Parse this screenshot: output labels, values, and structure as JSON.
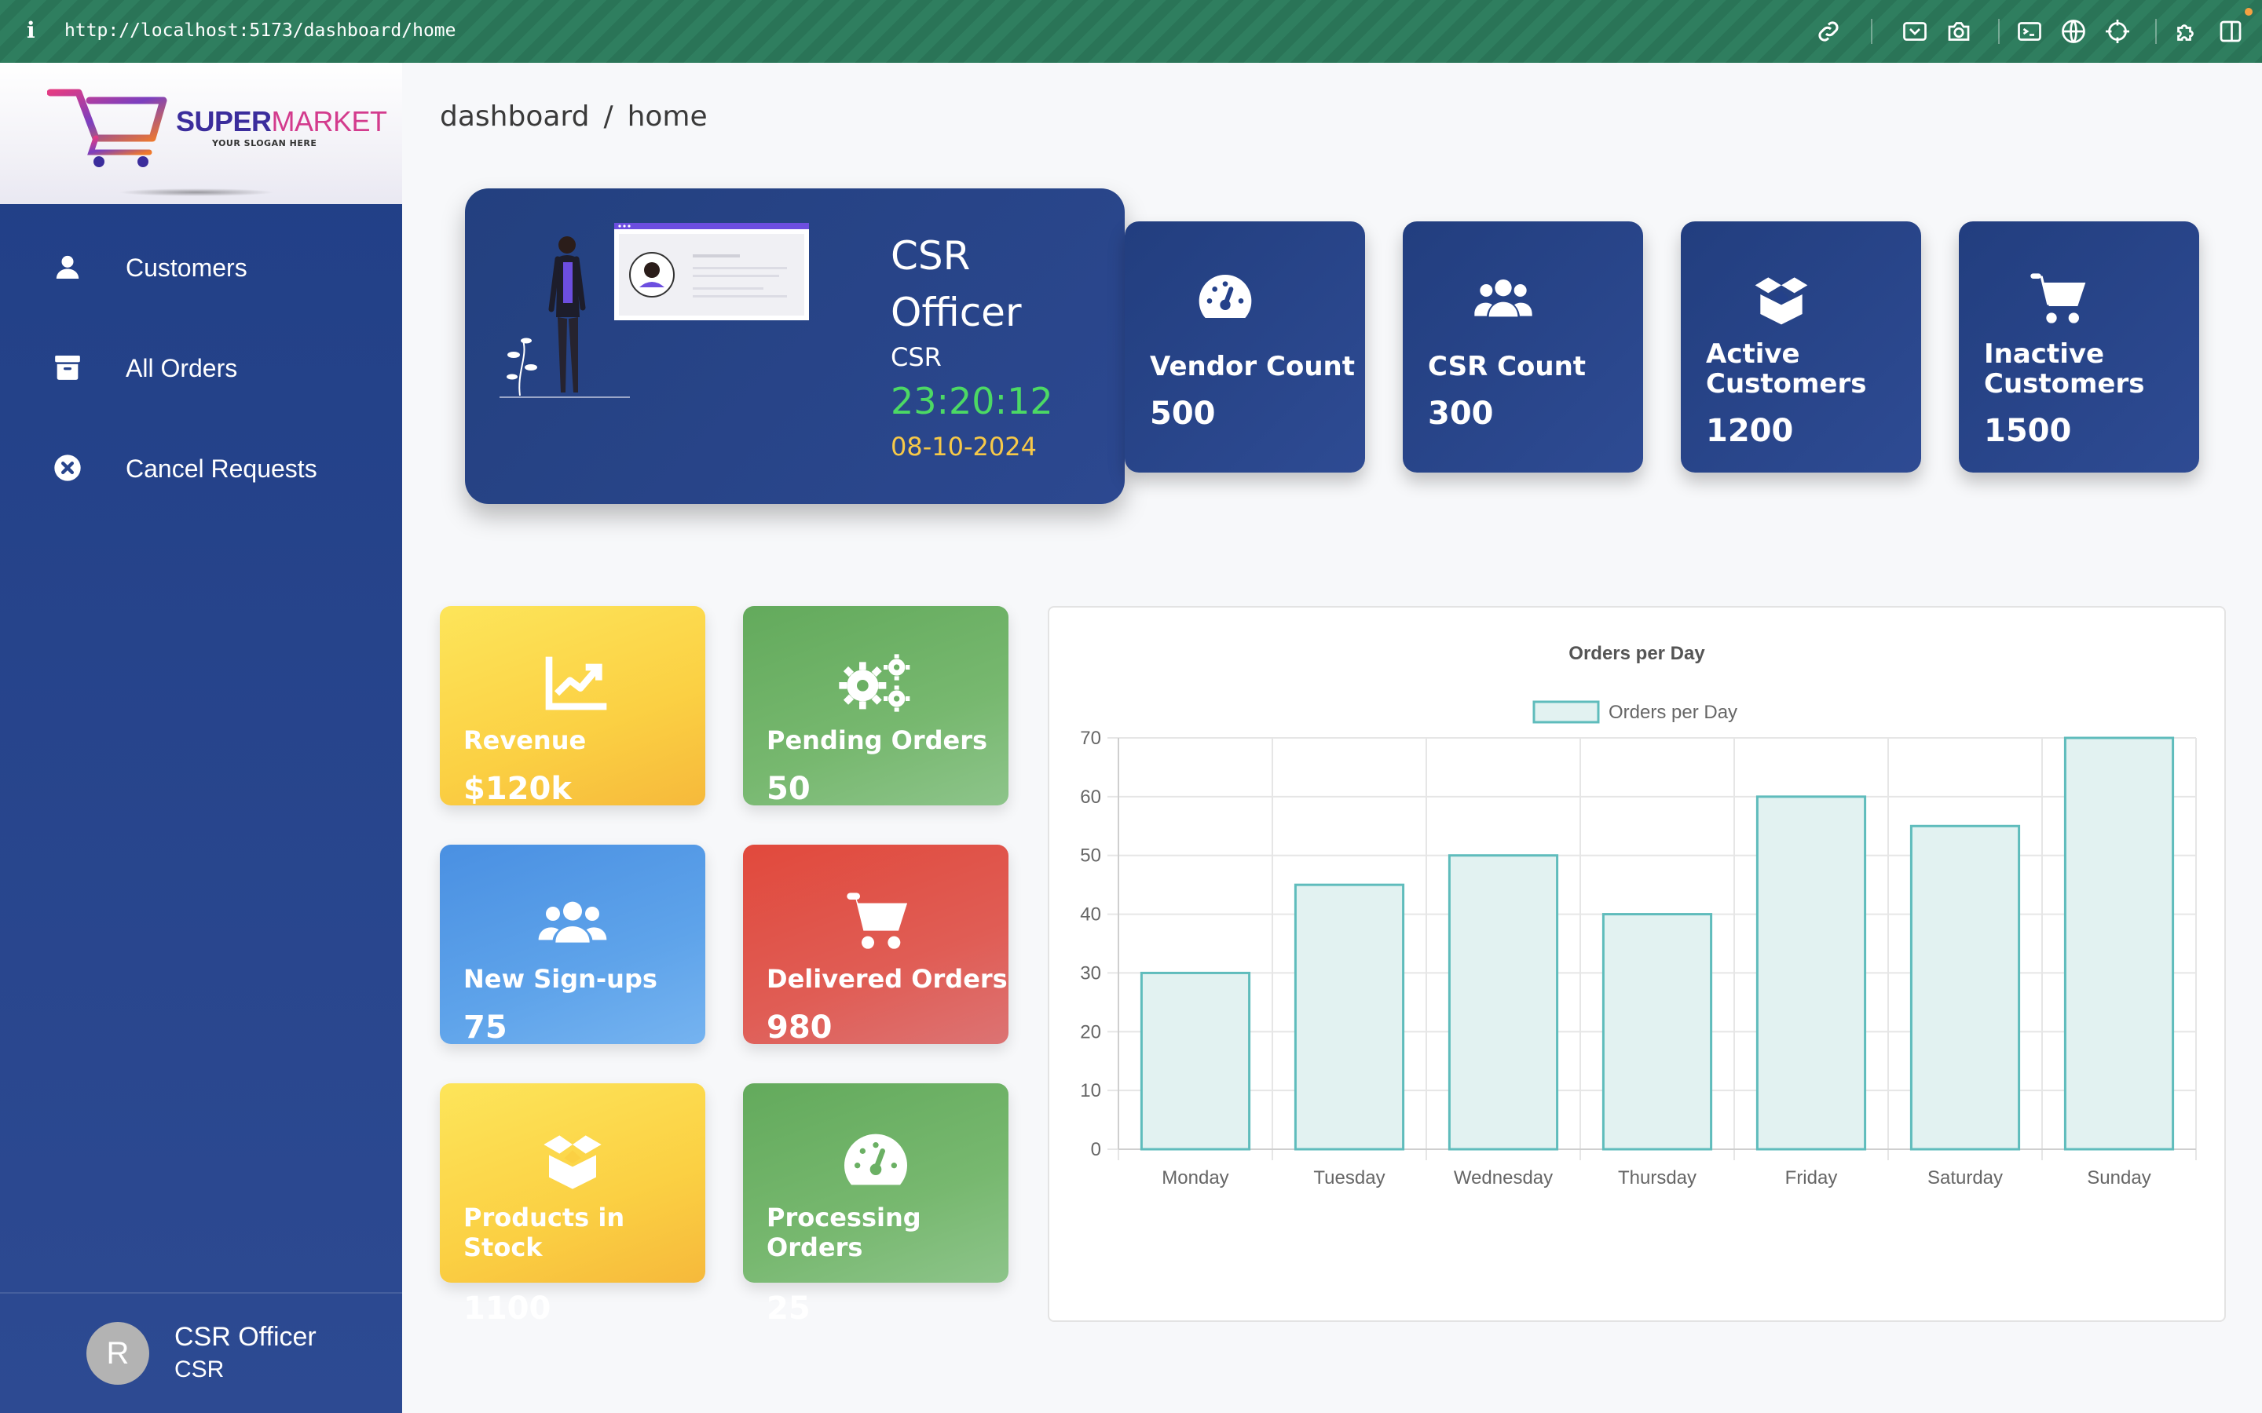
{
  "browser": {
    "url": "http://localhost:5173/dashboard/home",
    "info_glyph": "i",
    "toolbar_icons": [
      "link-icon",
      "screenshot-icon",
      "camera-icon",
      "terminal-icon",
      "globe-icon",
      "crosshair-icon",
      "extension-icon",
      "sidebar-toggle-icon"
    ]
  },
  "logo": {
    "brand_a": "SUPER",
    "brand_b": "MARKET",
    "slogan": "YOUR SLOGAN HERE"
  },
  "sidebar": {
    "items": [
      {
        "label": "Customers",
        "icon": "user-icon"
      },
      {
        "label": "All Orders",
        "icon": "archive-icon"
      },
      {
        "label": "Cancel Requests",
        "icon": "cancel-circle-icon"
      }
    ],
    "user": {
      "initial": "R",
      "name": "CSR Officer",
      "role": "CSR"
    }
  },
  "breadcrumb": {
    "root": "dashboard",
    "separator": "/",
    "current": "home"
  },
  "profile": {
    "title": "CSR Officer",
    "role": "CSR",
    "time": "23:20:12",
    "date": "08-10-2024"
  },
  "stats": [
    {
      "label": "Vendor Count",
      "value": "500",
      "icon": "gauge-icon"
    },
    {
      "label": "CSR Count",
      "value": "300",
      "icon": "users-icon"
    },
    {
      "label": "Active Customers",
      "value": "1200",
      "icon": "box-open-icon"
    },
    {
      "label": "Inactive Customers",
      "value": "1500",
      "icon": "cart-icon"
    }
  ],
  "tiles": [
    {
      "label": "Revenue",
      "value": "$120k",
      "icon": "trend-chart-icon",
      "color": "yellow"
    },
    {
      "label": "Pending Orders",
      "value": "50",
      "icon": "gears-icon",
      "color": "green"
    },
    {
      "label": "New Sign-ups",
      "value": "75",
      "icon": "users-icon",
      "color": "blue"
    },
    {
      "label": "Delivered Orders",
      "value": "980",
      "icon": "cart-icon",
      "color": "red"
    },
    {
      "label": "Products in Stock",
      "value": "1100",
      "icon": "box-open-icon",
      "color": "yellow"
    },
    {
      "label": "Processing Orders",
      "value": "25",
      "icon": "gauge-icon",
      "color": "green"
    }
  ],
  "colors": {
    "sidebar": "#213f86",
    "time": "#4cd964",
    "date": "#f7c948",
    "bar_fill": "#e2f2f1",
    "bar_stroke": "#5fbcbc"
  },
  "chart_data": {
    "type": "bar",
    "title": "Orders per Day",
    "categories": [
      "Monday",
      "Tuesday",
      "Wednesday",
      "Thursday",
      "Friday",
      "Saturday",
      "Sunday"
    ],
    "series": [
      {
        "name": "Orders per Day",
        "values": [
          30,
          45,
          50,
          40,
          60,
          55,
          70
        ]
      }
    ],
    "ylim": [
      0,
      70
    ],
    "yticks": [
      0,
      10,
      20,
      30,
      40,
      50,
      60,
      70
    ],
    "grid": true,
    "legend": "top"
  }
}
